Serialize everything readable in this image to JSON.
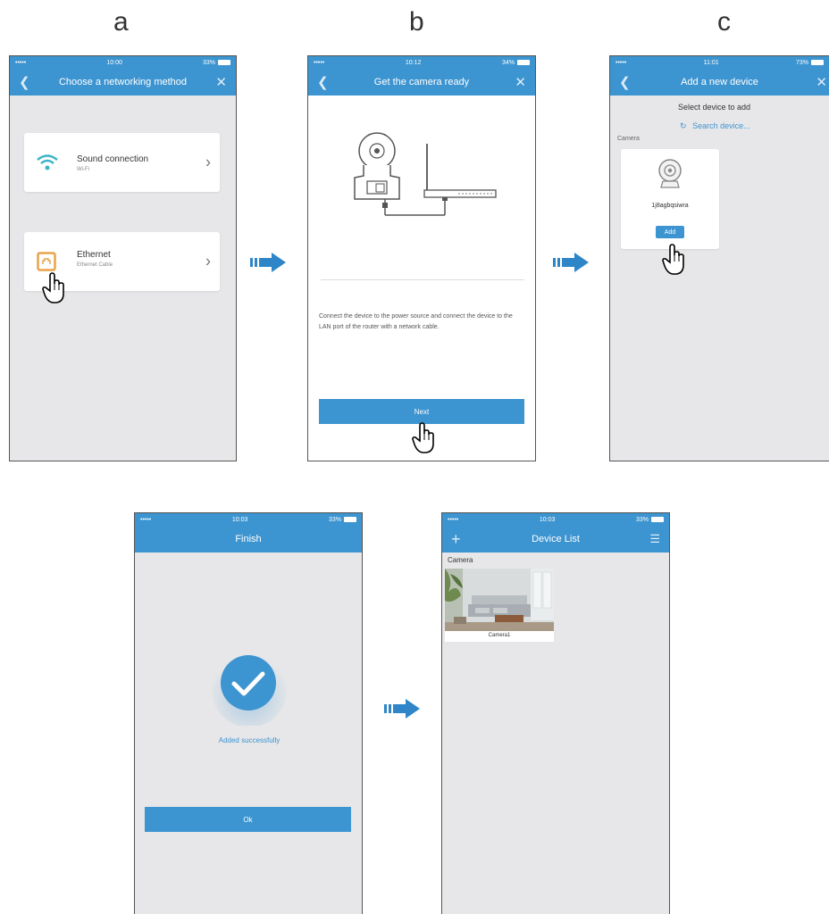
{
  "steps": {
    "a": "a",
    "b": "b",
    "c": "c"
  },
  "screen_a": {
    "title": "Choose a networking method",
    "status_time": "10:00",
    "status_batt": "33%",
    "option1": {
      "title": "Sound connection",
      "sub": "Wi-Fi"
    },
    "option2": {
      "title": "Ethernet",
      "sub": "Ethernet Cable"
    }
  },
  "screen_b": {
    "title": "Get the camera ready",
    "status_time": "10:12",
    "status_batt": "34%",
    "instructions": "Connect the device to the power source and connect the device to the LAN port of the router with a network cable.",
    "next_label": "Next"
  },
  "screen_c": {
    "title": "Add a new device",
    "status_time": "11:01",
    "status_batt": "73%",
    "select_text": "Select device to add",
    "search_text": "Search device...",
    "section_label": "Camera",
    "device_name": "1j8agbqsiwra",
    "add_label": "Add"
  },
  "screen_d": {
    "title": "Finish",
    "status_time": "10:03",
    "status_batt": "33%",
    "success_text": "Added successfully",
    "ok_label": "Ok"
  },
  "screen_e": {
    "title": "Device List",
    "status_time": "10:03",
    "status_batt": "33%",
    "section_label": "Camera",
    "camera_name": "Camera1"
  },
  "colors": {
    "accent": "#3c94d0",
    "background": "#e7e7e9",
    "wifi": "#3bb4c8",
    "ethernet": "#e8a34a"
  },
  "icons": [
    "back-icon",
    "close-icon",
    "wifi-icon",
    "ethernet-icon",
    "chevron-right-icon",
    "refresh-icon",
    "camera-icon",
    "hand-cursor-icon",
    "check-icon",
    "plus-icon",
    "menu-icon",
    "arrow-right-icon"
  ]
}
